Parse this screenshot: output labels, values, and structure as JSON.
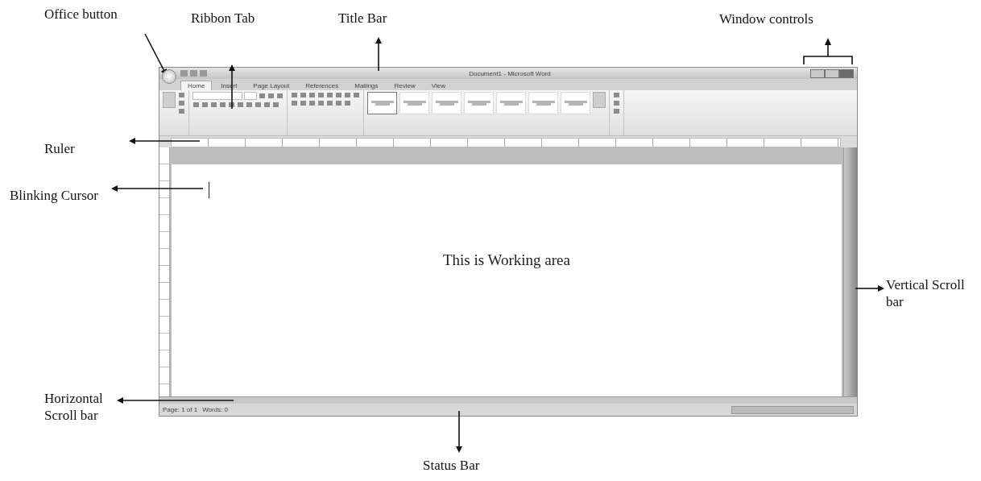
{
  "annotations": [
    {
      "kind": "office",
      "text": "Office button"
    },
    {
      "kind": "ribbon",
      "text": "Ribbon Tab"
    },
    {
      "kind": "title",
      "text": "Title Bar"
    },
    {
      "kind": "controls",
      "text": "Window controls"
    },
    {
      "kind": "ruler",
      "text": "Ruler"
    },
    {
      "kind": "cursor",
      "text": "Blinking Cursor"
    },
    {
      "kind": "vscroll",
      "text": "Vertical Scroll bar"
    },
    {
      "kind": "hscroll",
      "text": "Horizontal Scroll bar"
    },
    {
      "kind": "status",
      "text": "Status Bar"
    }
  ],
  "window": {
    "title": "Document1 - Microsoft Word"
  },
  "tabs": [
    {
      "label": "Home",
      "selected": true
    },
    {
      "label": "Insert",
      "selected": false
    },
    {
      "label": "Page Layout",
      "selected": false
    },
    {
      "label": "References",
      "selected": false
    },
    {
      "label": "Mailings",
      "selected": false
    },
    {
      "label": "Review",
      "selected": false
    },
    {
      "label": "View",
      "selected": false
    }
  ],
  "ribbon": {
    "groups": [
      {
        "kind": "clipboard"
      },
      {
        "kind": "font"
      },
      {
        "kind": "paragraph"
      },
      {
        "kind": "styles",
        "styles": [
          {
            "selected": true
          },
          {
            "selected": false
          },
          {
            "selected": false
          },
          {
            "selected": false
          },
          {
            "selected": false
          },
          {
            "selected": false
          },
          {
            "selected": false
          }
        ]
      },
      {
        "kind": "editing"
      }
    ]
  },
  "document": {
    "text": "This is Working area"
  },
  "status_bar": {
    "items": [
      "Page: 1 of 1",
      "Words: 0"
    ]
  }
}
